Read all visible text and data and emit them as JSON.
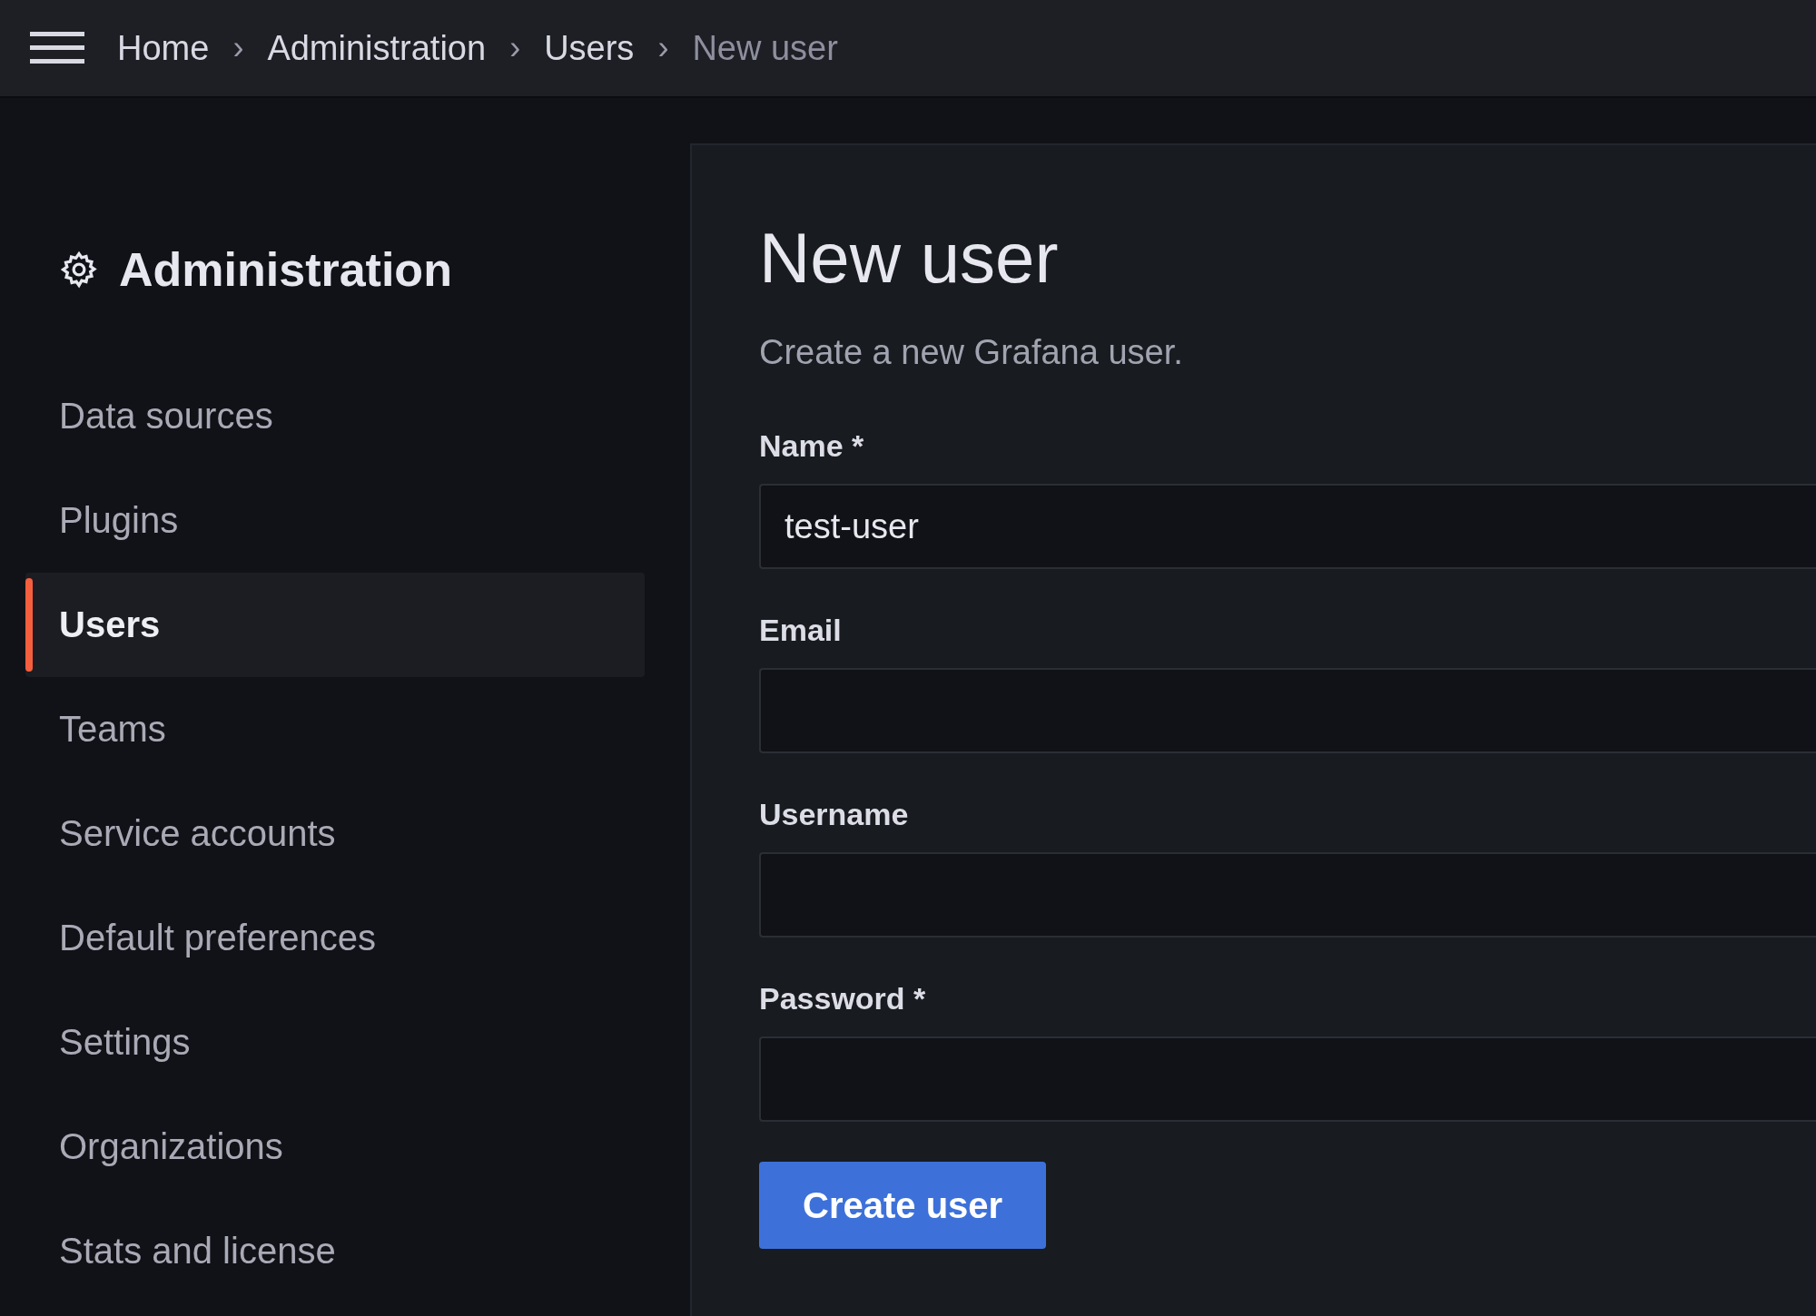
{
  "breadcrumbs": [
    {
      "label": "Home",
      "current": false
    },
    {
      "label": "Administration",
      "current": false
    },
    {
      "label": "Users",
      "current": false
    },
    {
      "label": "New user",
      "current": true
    }
  ],
  "breadcrumb_separator": "›",
  "sidebar": {
    "title": "Administration",
    "items": [
      {
        "label": "Data sources",
        "selected": false
      },
      {
        "label": "Plugins",
        "selected": false
      },
      {
        "label": "Users",
        "selected": true
      },
      {
        "label": "Teams",
        "selected": false
      },
      {
        "label": "Service accounts",
        "selected": false
      },
      {
        "label": "Default preferences",
        "selected": false
      },
      {
        "label": "Settings",
        "selected": false
      },
      {
        "label": "Organizations",
        "selected": false
      },
      {
        "label": "Stats and license",
        "selected": false
      }
    ]
  },
  "page": {
    "title": "New user",
    "subtitle": "Create a new Grafana user.",
    "fields": [
      {
        "label": "Name *",
        "value": "test-user"
      },
      {
        "label": "Email"
      },
      {
        "label": "Username"
      },
      {
        "label": "Password *"
      }
    ],
    "submit": "Create user"
  }
}
